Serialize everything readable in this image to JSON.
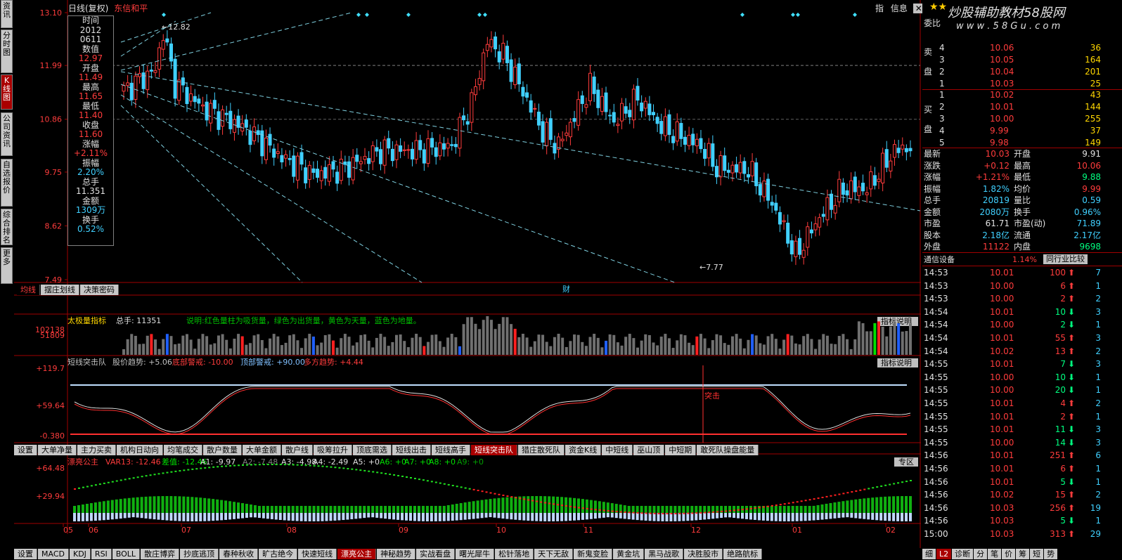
{
  "left_nav": [
    "分时图",
    "K线图",
    "公司资讯",
    "自选报价",
    "综合排名",
    "更多"
  ],
  "left_nav_top": "资讯",
  "chart_header": {
    "period": "日线(复权)",
    "stock": "东信和平",
    "link1": "指",
    "link2": "信息"
  },
  "price_axis": [
    "13.10",
    "11.99",
    "10.86",
    "9.75",
    "8.62",
    "7.49"
  ],
  "price_marks": {
    "high": "12.82",
    "low": "7.77"
  },
  "infobox": [
    {
      "t": "时间",
      "c": "w"
    },
    {
      "t": "2012",
      "c": "w"
    },
    {
      "t": "0611",
      "c": "w"
    },
    {
      "t": "数值",
      "c": "w"
    },
    {
      "t": "12.97",
      "c": "r"
    },
    {
      "t": "开盘",
      "c": "w"
    },
    {
      "t": "11.49",
      "c": "r"
    },
    {
      "t": "最高",
      "c": "w"
    },
    {
      "t": "11.65",
      "c": "r"
    },
    {
      "t": "最低",
      "c": "w"
    },
    {
      "t": "11.40",
      "c": "r"
    },
    {
      "t": "收盘",
      "c": "w"
    },
    {
      "t": "11.60",
      "c": "r"
    },
    {
      "t": "涨幅",
      "c": "w"
    },
    {
      "t": "+2.11%",
      "c": "r"
    },
    {
      "t": "振幅",
      "c": "w"
    },
    {
      "t": "2.20%",
      "c": "c"
    },
    {
      "t": "总手",
      "c": "w"
    },
    {
      "t": "11.351",
      "c": "w"
    },
    {
      "t": "金额",
      "c": "w"
    },
    {
      "t": "1309万",
      "c": "c"
    },
    {
      "t": "换手",
      "c": "w"
    },
    {
      "t": "0.52%",
      "c": "c"
    }
  ],
  "main_tabs": [
    "均线",
    "摆庄划线",
    "决策密码"
  ],
  "cai_label": "财",
  "vol_panel": {
    "title": "太极量指标",
    "total_label": "总手:",
    "total": "11351",
    "desc": "说明:红色量柱为吸货量，绿色为出货量，黄色为天量，蓝色为地量。",
    "axis": [
      "102138",
      "51809"
    ],
    "btn": "指标说明"
  },
  "mid_panel": {
    "title": "短线突击队",
    "l1": "股价趋势:",
    "v1": "+5.06",
    "l2": "底部警戒:",
    "v2": "-10.00",
    "l3": "顶部警戒:",
    "v3": "+90.00",
    "l4": "多方趋势:",
    "v4": "+4.44",
    "axis": [
      "+119.7",
      "+59.64",
      "-0.380"
    ],
    "btn": "指标说明",
    "tuji": "突击"
  },
  "mid_tabs": [
    "设置",
    "大单净量",
    "主力买卖",
    "机构日动向",
    "均笔成交",
    "散户数量",
    "大单金额",
    "散户线",
    "吸筹拉升",
    "顶底需选",
    "短线出击",
    "短线高手",
    "短线突击队",
    "猎庄散死队",
    "资金K线",
    "中短线",
    "巫山顶",
    "中短期",
    "敢死队操盘能量"
  ],
  "mid_tab_active": 12,
  "low_panel": {
    "title": "漂亮公主",
    "l0": "VAR13:",
    "v0": "-12.46",
    "l1": "差值:",
    "v1": "-12.46",
    "a1": "A1:",
    "av1": "-9.97",
    "a2": "A2:",
    "av2": "-7.48",
    "a3": "A3:",
    "av3": "-4.98",
    "a4": "A4:",
    "av4": "-2.49",
    "a5": "A5:",
    "av5": "+0",
    "a6": "A6:",
    "av6": "+0",
    "a7": "A7:",
    "av7": "+0",
    "a8": "A8:",
    "av8": "+0",
    "a9": "A9:",
    "av9": "+0",
    "axis": [
      "+64.48",
      "+29.94"
    ],
    "btn": "专区"
  },
  "date_axis": [
    "05",
    "06",
    "07",
    "08",
    "09",
    "10",
    "11",
    "12",
    "01",
    "02"
  ],
  "bottom_tabs": [
    "设置",
    "MACD",
    "KDJ",
    "RSI",
    "BOLL",
    "散庄博弈",
    "抄底逃顶",
    "春种秋收",
    "旷古绝今",
    "快速短线",
    "漂亮公主",
    "神秘趋势",
    "实战看盘",
    "曙光犀牛",
    "松针落地",
    "天下无敌",
    "新鬼变脸",
    "黄金坑",
    "黑马战歌",
    "决胜股市",
    "绝路航标"
  ],
  "bottom_tab_active": 10,
  "right": {
    "brand": "炒股辅助教材58股网",
    "url": "w w w . 5 8 G u . c o m",
    "weibi": "委比",
    "sell_label": "卖盘",
    "buy_label": "买盘",
    "sell": [
      [
        "4",
        "10.06",
        "36"
      ],
      [
        "3",
        "10.05",
        "164"
      ],
      [
        "2",
        "10.04",
        "201"
      ],
      [
        "1",
        "10.03",
        "25"
      ]
    ],
    "buy": [
      [
        "1",
        "10.02",
        "43"
      ],
      [
        "2",
        "10.01",
        "144"
      ],
      [
        "3",
        "10.00",
        "255"
      ],
      [
        "4",
        "9.99",
        "37"
      ],
      [
        "5",
        "9.98",
        "149"
      ]
    ],
    "stats": [
      [
        "最新",
        "10.03",
        "开盘",
        "9.91"
      ],
      [
        "涨跌",
        "+0.12",
        "最高",
        "10.06"
      ],
      [
        "涨幅",
        "+1.21%",
        "最低",
        "9.88"
      ],
      [
        "振幅",
        "1.82%",
        "均价",
        "9.99"
      ],
      [
        "总手",
        "20819",
        "量比",
        "0.59"
      ],
      [
        "金额",
        "2080万",
        "换手",
        "0.96%"
      ],
      [
        "市盈",
        "61.71",
        "市盈(动)",
        "71.89"
      ],
      [
        "股本",
        "2.18亿",
        "流通",
        "2.17亿"
      ],
      [
        "外盘",
        "11122",
        "内盘",
        "9698"
      ]
    ],
    "sector": {
      "name": "通信设备",
      "pct": "1.14%",
      "btn": "同行业比较"
    },
    "ticks": [
      [
        "14:53",
        "10.01",
        "100",
        "up",
        "7"
      ],
      [
        "14:53",
        "10.00",
        "6",
        "up",
        "1"
      ],
      [
        "14:53",
        "10.00",
        "2",
        "up",
        "2"
      ],
      [
        "14:54",
        "10.01",
        "10",
        "down",
        "3"
      ],
      [
        "14:54",
        "10.00",
        "2",
        "down",
        "1"
      ],
      [
        "14:54",
        "10.01",
        "55",
        "up",
        "3"
      ],
      [
        "14:54",
        "10.02",
        "13",
        "up",
        "2"
      ],
      [
        "14:55",
        "10.01",
        "7",
        "down",
        "3"
      ],
      [
        "14:55",
        "10.00",
        "10",
        "down",
        "1"
      ],
      [
        "14:55",
        "10.00",
        "20",
        "down",
        "1"
      ],
      [
        "14:55",
        "10.01",
        "4",
        "up",
        "2"
      ],
      [
        "14:55",
        "10.01",
        "2",
        "up",
        "1"
      ],
      [
        "14:55",
        "10.01",
        "11",
        "down",
        "3"
      ],
      [
        "14:55",
        "10.00",
        "14",
        "down",
        "3"
      ],
      [
        "14:56",
        "10.01",
        "251",
        "up",
        "6"
      ],
      [
        "14:56",
        "10.01",
        "6",
        "up",
        "1"
      ],
      [
        "14:56",
        "10.01",
        "5",
        "down",
        "1"
      ],
      [
        "14:56",
        "10.02",
        "15",
        "up",
        "2"
      ],
      [
        "14:56",
        "10.03",
        "256",
        "up",
        "19"
      ],
      [
        "14:56",
        "10.03",
        "5",
        "down",
        "1"
      ],
      [
        "15:00",
        "10.03",
        "313",
        "up",
        "29"
      ]
    ],
    "bottom_tabs": [
      "细",
      "L2",
      "诊断",
      "分",
      "笔",
      "价",
      "筹",
      "短",
      "势"
    ]
  },
  "colors": {
    "up": "#ff3c3c",
    "down": "#00ff80",
    "cyan": "#40d0ff",
    "bg": "#000000",
    "grid": "#a00000"
  }
}
